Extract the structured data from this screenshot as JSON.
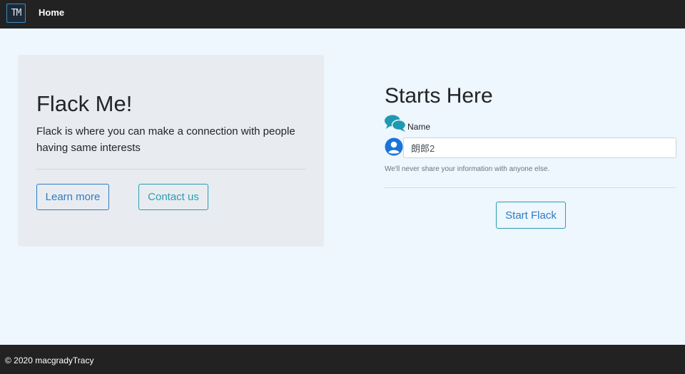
{
  "navbar": {
    "logo_text": "TM",
    "home_label": "Home"
  },
  "jumbotron": {
    "title": "Flack Me!",
    "description": "Flack is where you can make a connection with people having same interests",
    "learn_more_label": "Learn more",
    "contact_us_label": "Contact us"
  },
  "form": {
    "heading": "Starts Here",
    "name_label": "Name",
    "name_value": "朗郎2",
    "help_text": "We'll never share your information with anyone else.",
    "submit_label": "Start Flack"
  },
  "footer": {
    "copyright": "© 2020 macgradyTracy"
  },
  "icons": {
    "chat": "comments-icon",
    "user": "user-circle-icon"
  },
  "colors": {
    "navbar_bg": "#222222",
    "page_bg": "#eef6fe",
    "primary": "#2e7bc4",
    "info": "#2a9db3",
    "icon_teal": "#1e9ab0",
    "icon_blue": "#1a73d9"
  }
}
